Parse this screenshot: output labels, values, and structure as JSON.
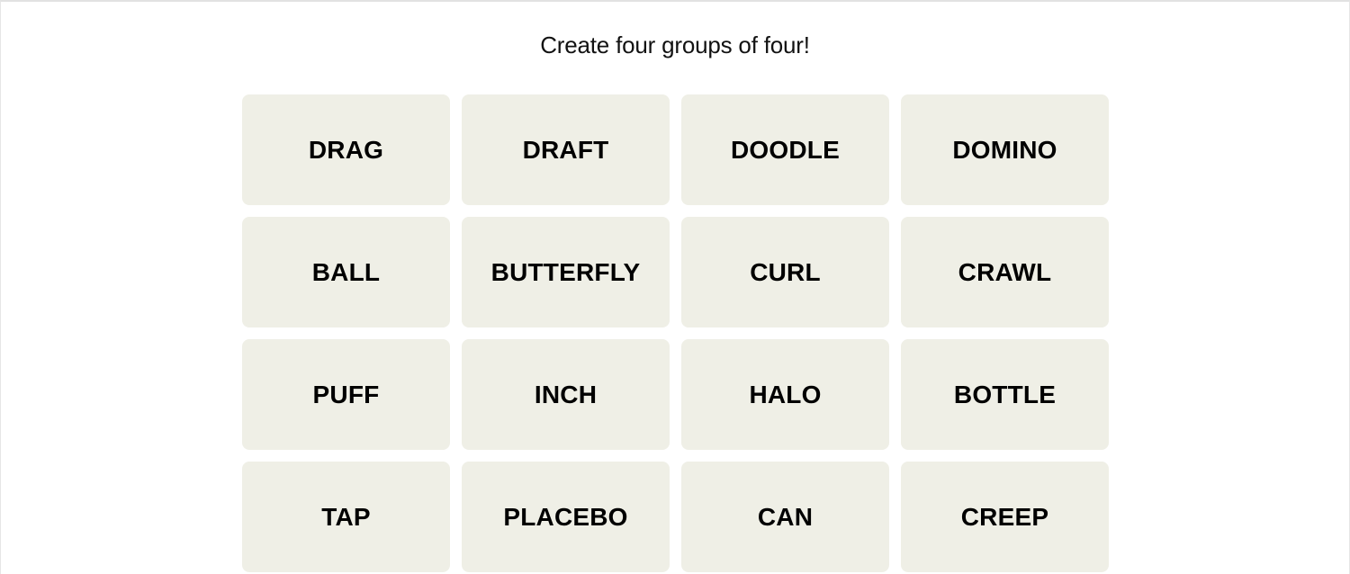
{
  "game": {
    "instructions": "Create four groups of four!",
    "tiles": [
      "DRAG",
      "DRAFT",
      "DOODLE",
      "DOMINO",
      "BALL",
      "BUTTERFLY",
      "CURL",
      "CRAWL",
      "PUFF",
      "INCH",
      "HALO",
      "BOTTLE",
      "TAP",
      "PLACEBO",
      "CAN",
      "CREEP"
    ],
    "colors": {
      "tile_background": "#efefe6",
      "tile_text": "#000000",
      "page_background": "#ffffff"
    }
  }
}
